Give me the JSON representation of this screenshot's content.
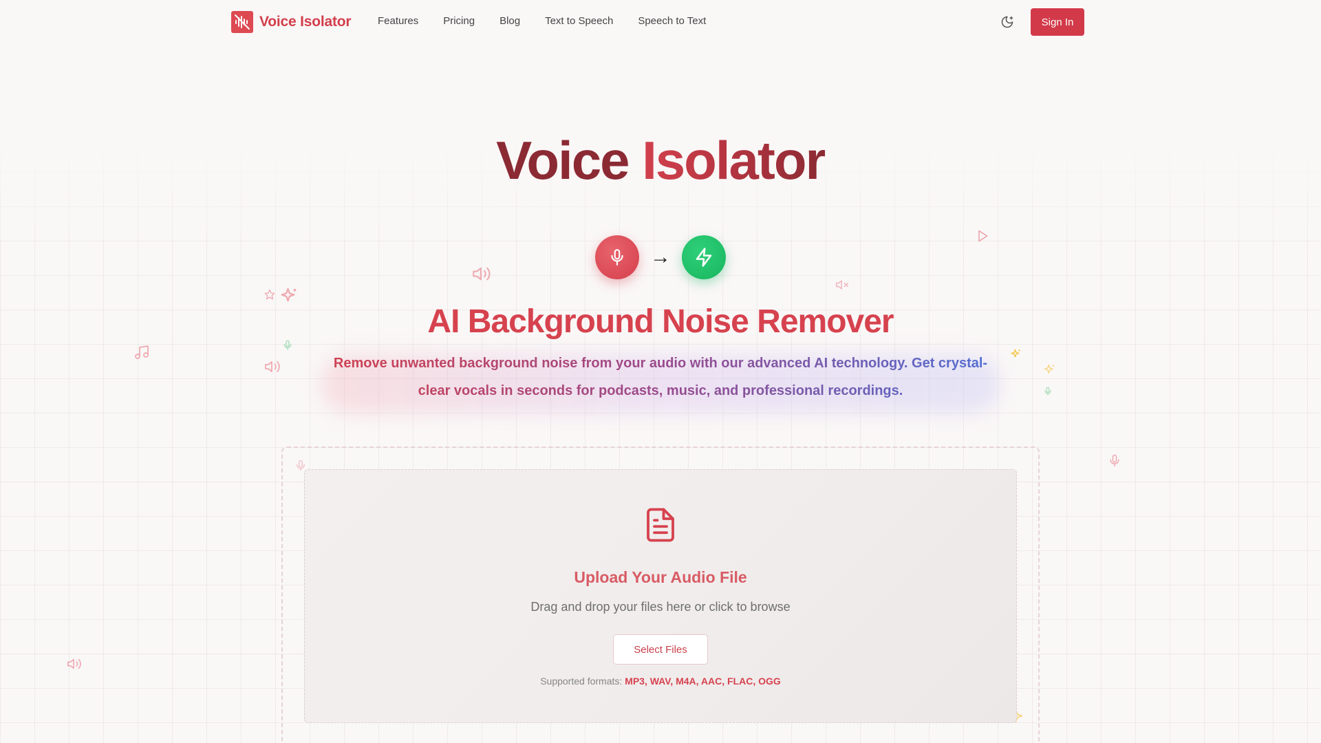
{
  "nav": {
    "brand": "Voice Isolator",
    "links": [
      "Features",
      "Pricing",
      "Blog",
      "Text to Speech",
      "Speech to Text"
    ],
    "theme_toggle_icon": "moon-sparkle-icon",
    "sign_in": "Sign In"
  },
  "hero": {
    "title_part1": "Voice",
    "title_part2": "Isolator",
    "flow_from_icon": "microphone-icon",
    "flow_arrow": "→",
    "flow_to_icon": "lightning-icon",
    "subtitle": "AI Background Noise Remover",
    "description": "Remove unwanted background noise from your audio with our advanced AI technology. Get crystal-clear vocals in seconds for podcasts, music, and professional recordings."
  },
  "upload": {
    "icon": "document-icon",
    "title": "Upload Your Audio File",
    "hint": "Drag and drop your files here or click to browse",
    "button": "Select Files",
    "formats_label": "Supported formats:",
    "formats": "MP3, WAV, M4A, AAC, FLAC, OGG"
  },
  "colors": {
    "brand_red": "#d23a49",
    "title_dark": "#8b2a33",
    "success_green": "#17b55e",
    "desc_blue": "#4b6fd6"
  }
}
